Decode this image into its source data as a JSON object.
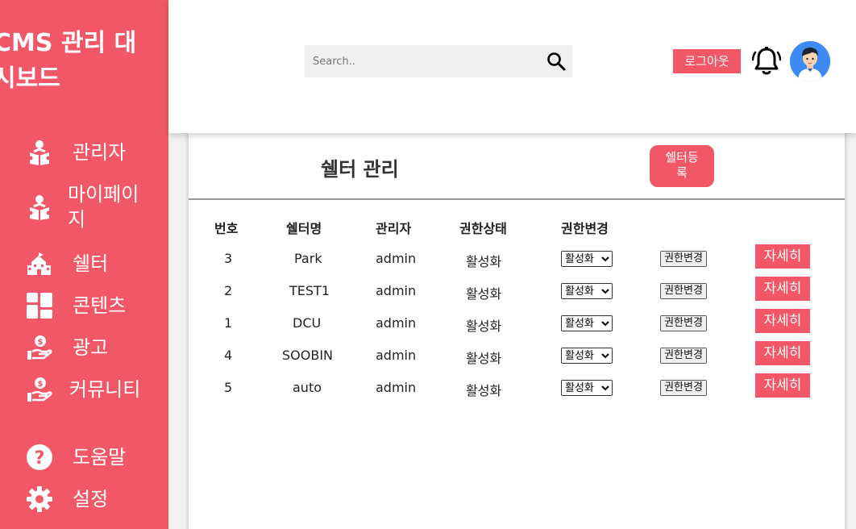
{
  "sidebar": {
    "brand": "CMS 관리 대시보드",
    "items": [
      {
        "label": "관리자",
        "icon": "reader-icon"
      },
      {
        "label": "마이페이지",
        "icon": "reader-icon"
      },
      {
        "label": "쉘터",
        "icon": "school-icon"
      },
      {
        "label": "콘텐츠",
        "icon": "grid-icon"
      },
      {
        "label": "광고",
        "icon": "hand-money-icon"
      },
      {
        "label": "커뮤니티",
        "icon": "hand-money-icon"
      },
      {
        "label": "도움말",
        "icon": "question-icon"
      },
      {
        "label": "설정",
        "icon": "gear-icon"
      }
    ]
  },
  "header": {
    "search_placeholder": "Search..",
    "logout_label": "로그아웃"
  },
  "main": {
    "title": "쉘터 관리",
    "register_label": "쉘터등록",
    "columns": [
      "번호",
      "쉘터명",
      "관리자",
      "권한상태",
      "권한변경"
    ],
    "select_option": "활성화",
    "change_label": "권한변경",
    "detail_label": "자세히",
    "rows": [
      {
        "no": "3",
        "name": "Park",
        "admin": "admin",
        "status": "활성화"
      },
      {
        "no": "2",
        "name": "TEST1",
        "admin": "admin",
        "status": "활성화"
      },
      {
        "no": "1",
        "name": "DCU",
        "admin": "admin",
        "status": "활성화"
      },
      {
        "no": "4",
        "name": "SOOBIN",
        "admin": "admin",
        "status": "활성화"
      },
      {
        "no": "5",
        "name": "auto",
        "admin": "admin",
        "status": "활성화"
      }
    ]
  },
  "colors": {
    "accent": "#f25767",
    "avatar_bg": "#3d8bf2"
  }
}
